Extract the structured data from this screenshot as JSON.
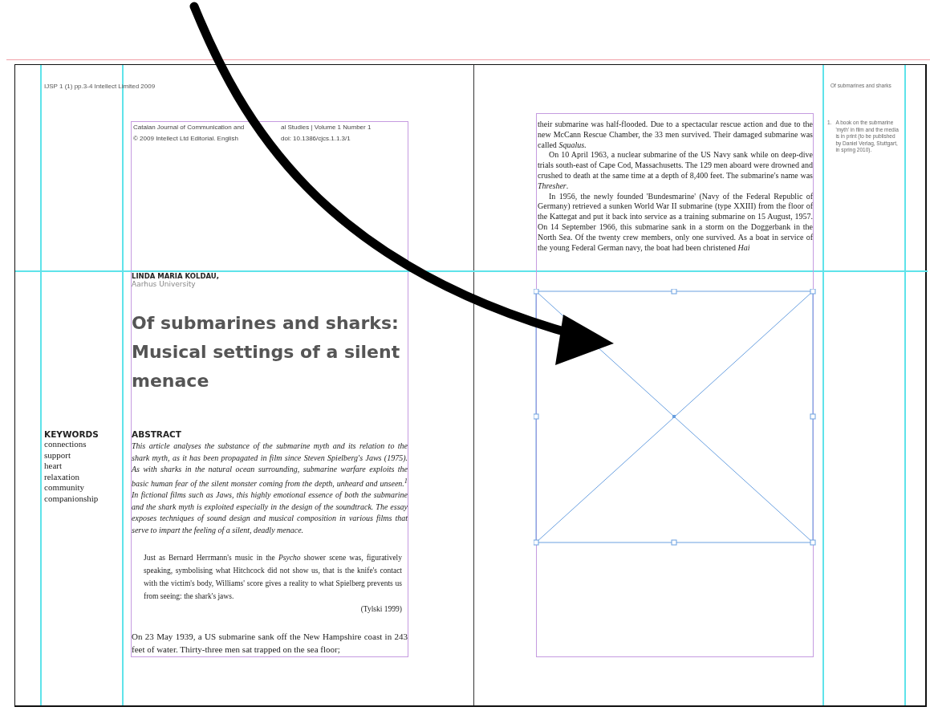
{
  "left_page": {
    "slug": "IJSP 1 (1) pp.3-4 Intellect Limited 2009",
    "running_head": [
      [
        "Catalan Journal of Communication and",
        "al Studies | Volume 1 Number 1"
      ],
      [
        "© 2009 Intellect Ltd Editorial. English",
        "doi: 10.1386/cjcs.1.1.3/1"
      ]
    ],
    "author": "LINDA MARIA KOLDAU,",
    "affiliation": "Aarhus University",
    "title": "Of submarines and sharks: Musical settings of a silent menace",
    "keywords": {
      "heading": "KEYWORDS",
      "items": [
        "connections",
        "support",
        "heart",
        "relaxation",
        "community",
        "companionship"
      ]
    },
    "abstract": {
      "heading": "ABSTRACT",
      "text": "This article analyses the substance of the submarine myth and its relation to the shark myth, as it has been propagated in film since Steven Spielberg's Jaws (1975). As with sharks in the natural ocean surrounding, submarine warfare exploits the basic human fear of the silent monster coming from the depth, unheard and unseen.$^{1}$ In fictional films such as Jaws, this highly emotional essence of both the submarine and the shark myth is exploited especially in the design of the soundtrack. The essay exposes techniques of sound design and musical composition in various films that serve to impart the feeling of a silent, deadly menace."
    },
    "quote": {
      "text": "Just as Bernard Herrmann's music in the *Psycho* shower scene was, figuratively speaking, symbolising what Hitchcock did not show us, that is the knife's contact with the victim's body, Williams' score gives a reality to what Spielberg prevents us from seeing: the shark's jaws.",
      "citation": "(Tylski 1999)"
    },
    "body": "On 23 May 1939, a US submarine sank off the New Hampshire coast in 243 feet of water. Thirty-three men sat trapped on the sea floor;"
  },
  "right_page": {
    "running_head": "Of submarines and sharks",
    "paragraphs": [
      "their submarine was half-flooded. Due to a spectacular rescue action and due to the new McCann Rescue Chamber, the 33 men survived. Their damaged submarine was called *Squalus*.",
      "On 10 April 1963, a nuclear submarine of the US Navy sank while on deep-dive trials south-east of Cape Cod, Massachusetts. The 129 men aboard were drowned and crushed to death at the same time at a depth of 8,400 feet. The submarine's name was *Thresher*.",
      "In 1956, the newly founded 'Bundesmarine' (Navy of the Federal Republic of Germany) retrieved a sunken World War II submarine (type XXIII) from the floor of the Kattegat and put it back into service as a training submarine on 15 August, 1957. On 14 September 1966, this submarine sank in a storm on the Doggerbank in the North Sea. Of the twenty crew members, only one survived. As a boat in service of the young Federal German navy, the boat had been christened *Hai*"
    ],
    "footnote": {
      "number": "1.",
      "text": "A book on the submarine 'myth' in film and the media is in print (to be published by Daniel Verlag, Stuttgart, in spring 2010)."
    }
  }
}
